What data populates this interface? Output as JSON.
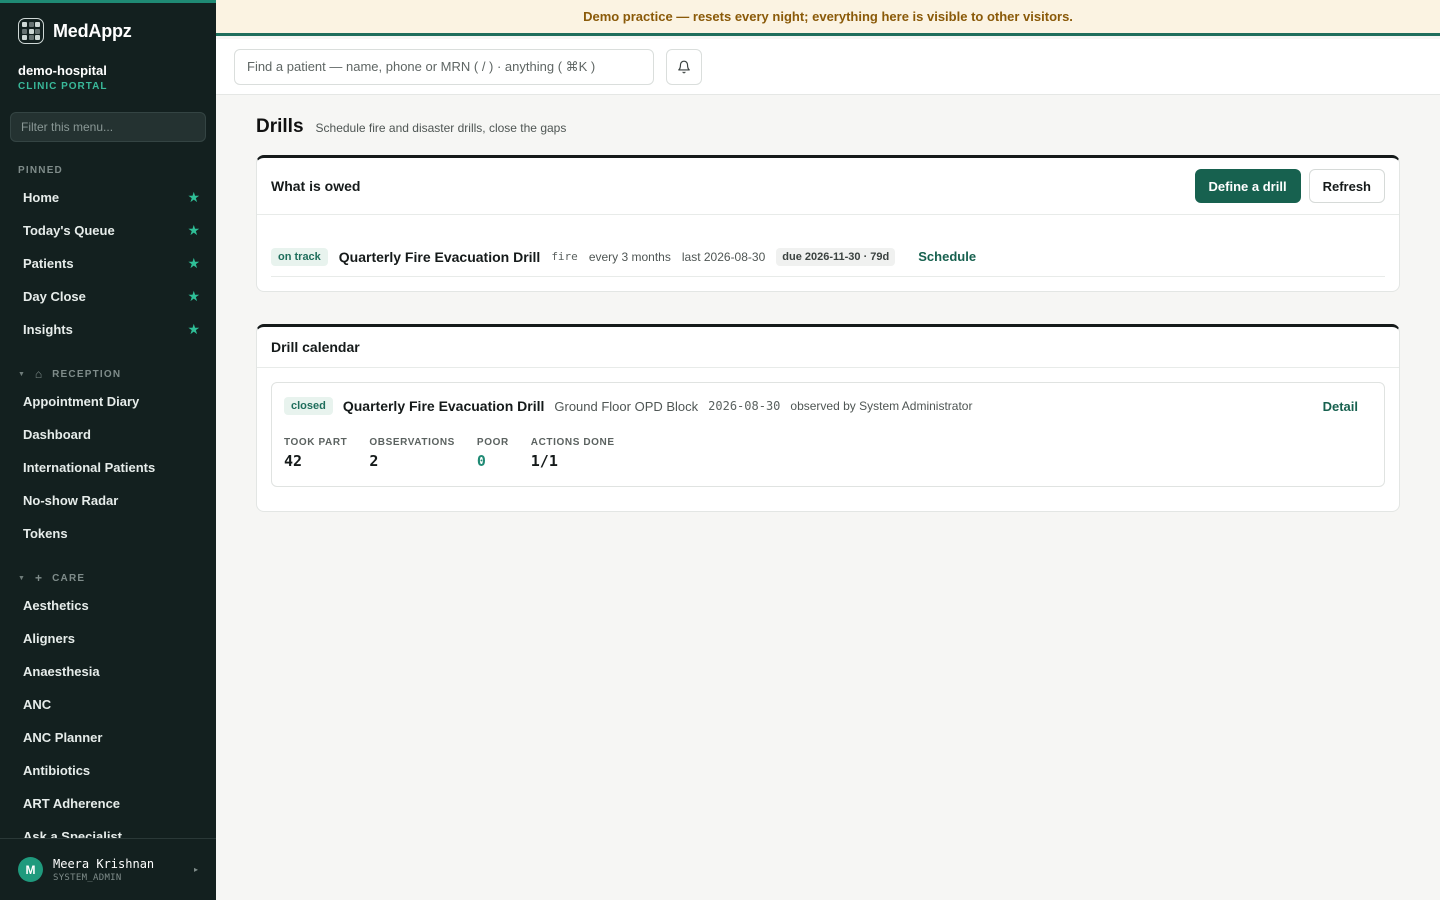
{
  "app": {
    "name": "MedAppz",
    "org": "demo-hospital",
    "org_sub": "CLINIC PORTAL"
  },
  "sidebar": {
    "filter_placeholder": "Filter this menu...",
    "pinned_label": "PINNED",
    "pinned": [
      {
        "label": "Home"
      },
      {
        "label": "Today's Queue"
      },
      {
        "label": "Patients"
      },
      {
        "label": "Day Close"
      },
      {
        "label": "Insights"
      }
    ],
    "reception_label": "RECEPTION",
    "reception": [
      {
        "label": "Appointment Diary"
      },
      {
        "label": "Dashboard"
      },
      {
        "label": "International Patients"
      },
      {
        "label": "No-show Radar"
      },
      {
        "label": "Tokens"
      }
    ],
    "care_label": "CARE",
    "care": [
      {
        "label": "Aesthetics"
      },
      {
        "label": "Aligners"
      },
      {
        "label": "Anaesthesia"
      },
      {
        "label": "ANC"
      },
      {
        "label": "ANC Planner"
      },
      {
        "label": "Antibiotics"
      },
      {
        "label": "ART Adherence"
      },
      {
        "label": "Ask a Specialist"
      }
    ],
    "user": {
      "initial": "M",
      "name": "Meera Krishnan",
      "role": "SYSTEM_ADMIN"
    }
  },
  "banner": {
    "text": "Demo practice — resets every night; everything here is visible to other visitors."
  },
  "topbar": {
    "search_placeholder": "Find a patient — name, phone or MRN ( / ) · anything ( ⌘K )"
  },
  "page": {
    "title": "Drills",
    "subtitle": "Schedule fire and disaster drills, close the gaps"
  },
  "owed": {
    "title": "What is owed",
    "define_label": "Define a drill",
    "refresh_label": "Refresh",
    "row": {
      "status": "on track",
      "name": "Quarterly Fire Evacuation Drill",
      "kind": "fire",
      "frequency": "every 3 months",
      "last": "last 2026-08-30",
      "due": "due 2026-11-30 · 79d",
      "action": "Schedule"
    }
  },
  "calendar": {
    "title": "Drill calendar",
    "entry": {
      "status": "closed",
      "name": "Quarterly Fire Evacuation Drill",
      "location": "Ground Floor OPD Block",
      "date": "2026-08-30",
      "observer": "observed by System Administrator",
      "action": "Detail",
      "stats": {
        "took_part_label": "TOOK PART",
        "took_part": "42",
        "observations_label": "OBSERVATIONS",
        "observations": "2",
        "poor_label": "POOR",
        "poor": "0",
        "actions_label": "ACTIONS DONE",
        "actions": "1/1"
      }
    }
  },
  "colors": {
    "accent": "#17614f",
    "sidebar_bg": "#13201f",
    "banner_bg": "#fbf3e2",
    "banner_text": "#8a5a09",
    "star": "#2fbf97"
  }
}
